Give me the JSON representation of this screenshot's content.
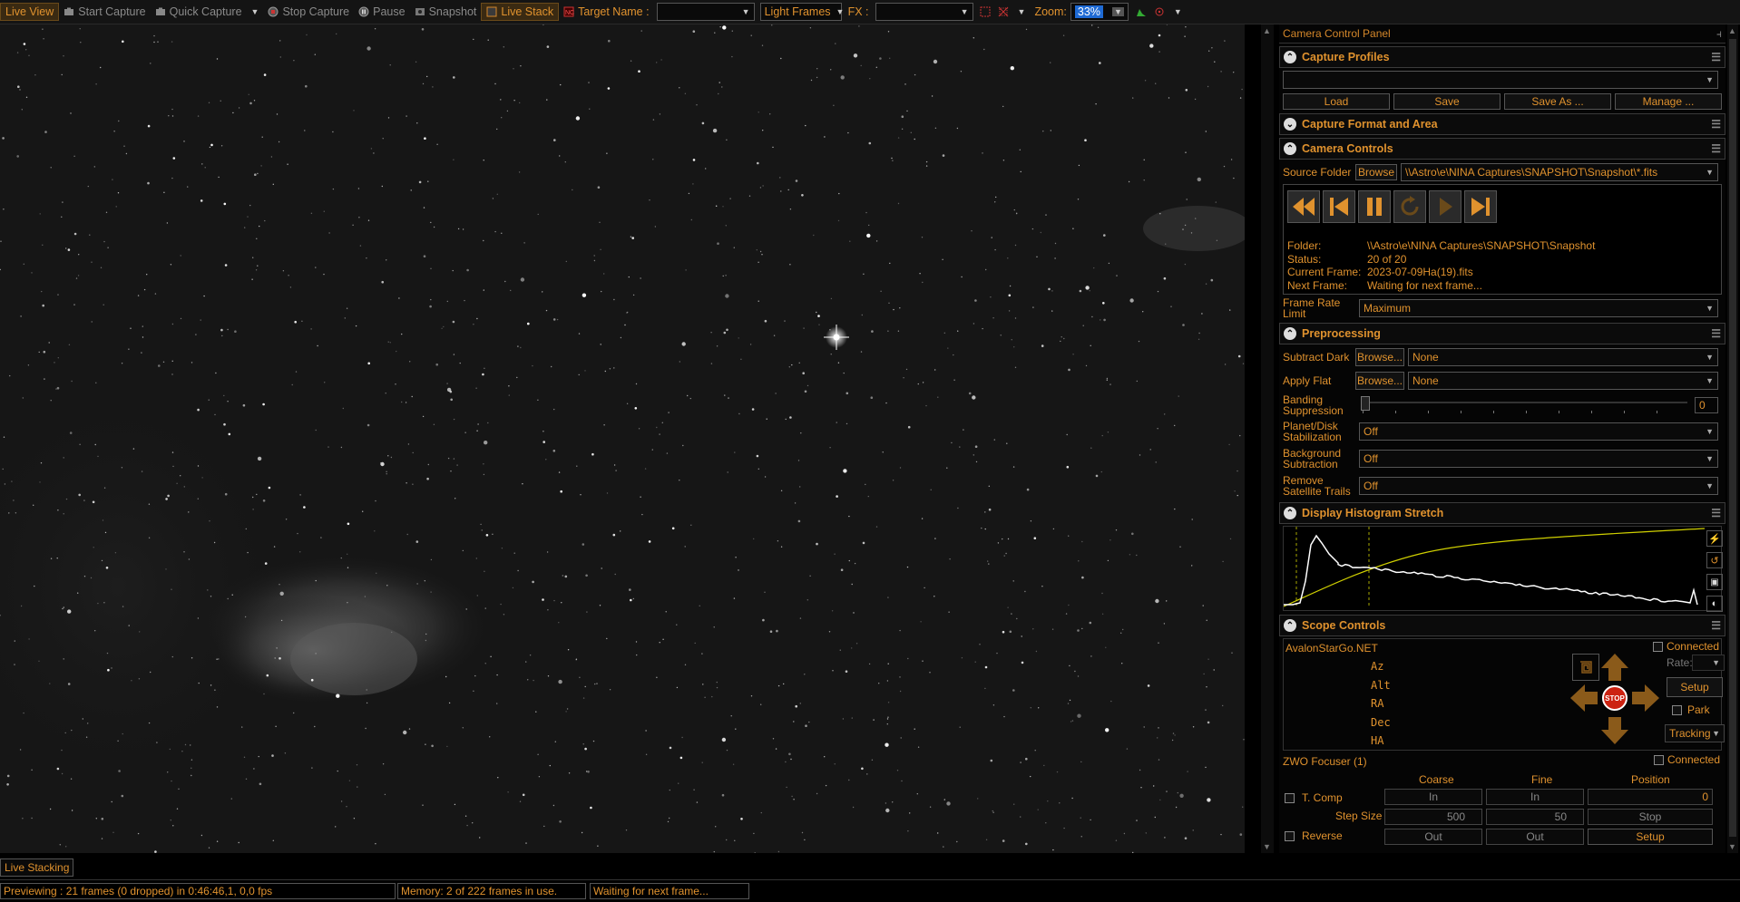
{
  "toolbar": {
    "live_view": "Live View",
    "start_capture": "Start Capture",
    "quick_capture": "Quick Capture",
    "stop_capture": "Stop Capture",
    "pause": "Pause",
    "snapshot": "Snapshot",
    "live_stack": "Live Stack",
    "target_name_label": "Target Name :",
    "target_name_value": "",
    "frame_type": "Light Frames",
    "fx_label": "FX :",
    "fx_value": "",
    "zoom_label": "Zoom:",
    "zoom_value": "33%"
  },
  "panel": {
    "title": "Camera Control Panel",
    "capture_profiles": {
      "heading": "Capture Profiles",
      "profile_value": "",
      "load": "Load",
      "save": "Save",
      "save_as": "Save As ...",
      "manage": "Manage ..."
    },
    "capture_format": {
      "heading": "Capture Format and Area"
    },
    "camera_controls": {
      "heading": "Camera Controls",
      "source_folder_label": "Source Folder",
      "browse": "Browse",
      "source_folder_value": "\\\\Astro\\e\\NINA Captures\\SNAPSHOT\\Snapshot\\*.fits",
      "folder_label": "Folder:",
      "folder_value": "\\\\Astro\\e\\NINA Captures\\SNAPSHOT\\Snapshot",
      "status_label": "Status:",
      "status_value": "20 of 20",
      "current_frame_label": "Current Frame:",
      "current_frame_value": "2023-07-09Ha(19).fits",
      "next_frame_label": "Next Frame:",
      "next_frame_value": "Waiting for next frame...",
      "frame_rate_label_1": "Frame Rate",
      "frame_rate_label_2": "Limit",
      "frame_rate_value": "Maximum"
    },
    "preprocessing": {
      "heading": "Preprocessing",
      "subtract_dark_label": "Subtract Dark",
      "subtract_dark_browse": "Browse...",
      "subtract_dark_value": "None",
      "apply_flat_label": "Apply Flat",
      "apply_flat_browse": "Browse...",
      "apply_flat_value": "None",
      "banding_label_1": "Banding",
      "banding_label_2": "Suppression",
      "banding_value": "0",
      "planet_label_1": "Planet/Disk",
      "planet_label_2": "Stabilization",
      "planet_value": "Off",
      "background_label_1": "Background",
      "background_label_2": "Subtraction",
      "background_value": "Off",
      "satellite_label_1": "Remove",
      "satellite_label_2": "Satellite Trails",
      "satellite_value": "Off"
    },
    "histogram": {
      "heading": "Display Histogram Stretch"
    },
    "scope": {
      "heading": "Scope Controls",
      "mount_name": "AvalonStarGo.NET",
      "connected_label": "Connected",
      "coords": [
        "Az",
        "Alt",
        "RA",
        "Dec",
        "HA"
      ],
      "rate_label": "Rate:",
      "stop_label": "STOP",
      "setup": "Setup",
      "park": "Park",
      "tracking": "Tracking"
    },
    "focuser": {
      "name": "ZWO Focuser (1)",
      "connected_label": "Connected",
      "coarse": "Coarse",
      "fine": "Fine",
      "position": "Position",
      "tcomp": "T. Comp",
      "in_label": "In",
      "position_value": "0",
      "step_size_label": "Step Size",
      "coarse_step": "500",
      "fine_step": "50",
      "stop": "Stop",
      "reverse": "Reverse",
      "out_label": "Out",
      "setup": "Setup"
    }
  },
  "bottom": {
    "live_stacking_tab": "Live Stacking",
    "status_previewing": "Previewing : 21 frames (0 dropped) in 0:46:46,1, 0,0 fps",
    "status_memory": "Memory: 2 of 222 frames in use.",
    "status_waiting": "Waiting for next frame..."
  }
}
